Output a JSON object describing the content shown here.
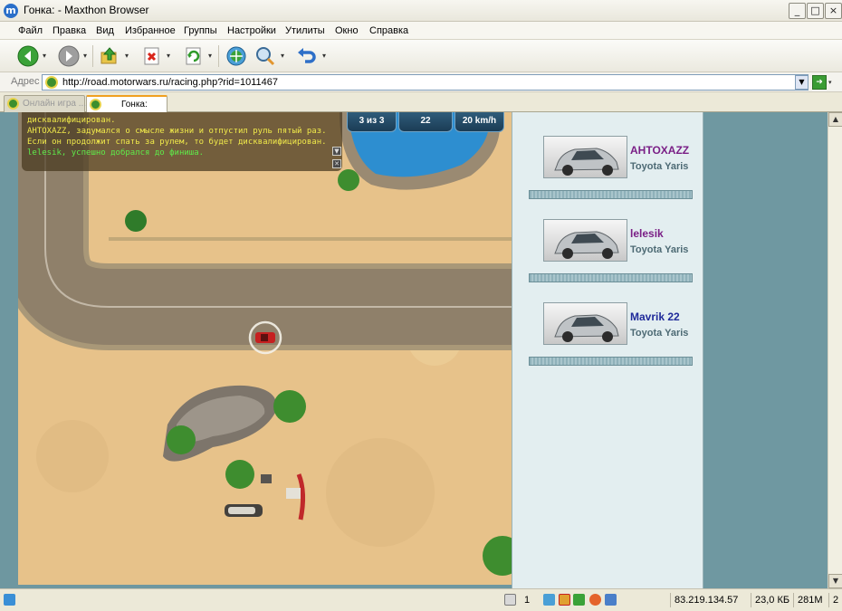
{
  "window": {
    "title": "Гонка: - Maxthon Browser",
    "controls": {
      "minimize": "_",
      "maximize": "□",
      "close": "×"
    }
  },
  "menu": [
    "Файл",
    "Правка",
    "Вид",
    "Избранное",
    "Группы",
    "Настройки",
    "Утилиты",
    "Окно",
    "Справка"
  ],
  "address": {
    "label": "Адрес",
    "url": "http://road.motorwars.ru/racing.php?rid=1011467"
  },
  "tabs": [
    {
      "label": "Онлайн игра ...",
      "active": false
    },
    {
      "label": "Гонка:",
      "active": true
    }
  ],
  "chat": {
    "lines": [
      {
        "text": "дисквалифицирован.",
        "color": "#f0e94a"
      },
      {
        "text": "AHTOXAZZ, задумался о смысле жизни и отпустил руль пятый раз.",
        "color": "#f0e94a"
      },
      {
        "text": "Если он продолжит спать за рулем, то будет дисквалифицирован.",
        "color": "#f0e94a"
      },
      {
        "text": "lelesik, успешно добрался до финиша.",
        "color": "#5fea4a"
      }
    ]
  },
  "hud": {
    "lap": "3 из 3",
    "position": "22",
    "speed": "20 km/h"
  },
  "players": [
    {
      "name": "AHTOXAZZ",
      "car": "Toyota Yaris",
      "name_color": "#7a1f86"
    },
    {
      "name": "lelesik",
      "car": "Toyota Yaris",
      "name_color": "#7a1f86"
    },
    {
      "name": "Mavrik 22",
      "car": "Toyota Yaris",
      "name_color": "#1f2a9a"
    }
  ],
  "status": {
    "tabs_count": "1",
    "ip": "83.219.134.57",
    "size": "23,0 КБ",
    "memory": "281M",
    "extra": "2"
  }
}
